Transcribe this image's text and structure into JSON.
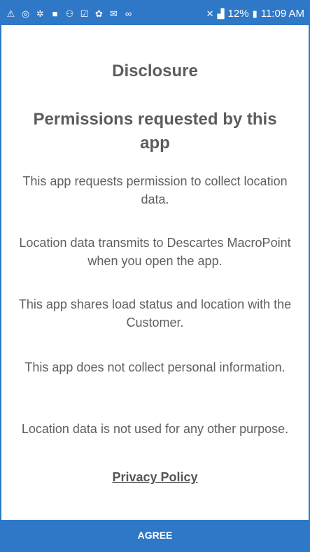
{
  "status_bar": {
    "icons_left": [
      "warning-icon",
      "wifi-icon",
      "signal-scan-icon",
      "chat-icon",
      "person-icon",
      "checkbox-icon",
      "robot-icon",
      "mail-icon",
      "voicemail-icon"
    ],
    "icons_left_glyphs": [
      "⚠",
      "◎",
      "✲",
      "■",
      "⚇",
      "☑",
      "✿",
      "✉",
      "∞"
    ],
    "mute_glyph": "✕",
    "signal_glyph": "▟",
    "battery_percent": "12%",
    "battery_glyph": "▮",
    "time": "11:09 AM"
  },
  "content": {
    "title": "Disclosure",
    "subtitle": "Permissions requested by this app",
    "paragraphs": [
      "This app requests permission to collect location data.",
      "Location data transmits to Descartes MacroPoint when you open the app.",
      "This app shares load status and location with the Customer.",
      "This app does not collect personal information.",
      "Location data is not used for any other purpose."
    ],
    "privacy_link": "Privacy Policy"
  },
  "footer": {
    "agree_label": "AGREE"
  },
  "colors": {
    "accent": "#2e78c7",
    "text": "#5f5f5f"
  }
}
